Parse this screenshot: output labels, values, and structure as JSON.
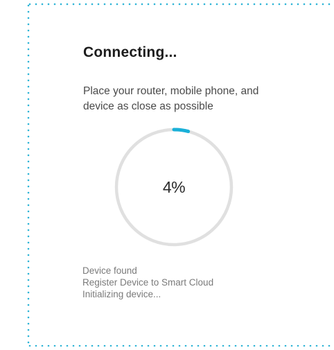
{
  "connecting": {
    "title": "Connecting...",
    "instruction_line1": "Place your router, mobile phone, and",
    "instruction_line2": "device as close as possible"
  },
  "progress": {
    "value": 4,
    "label": "4%",
    "track_color": "#e0e0e0",
    "fill_color": "#1ab0d8"
  },
  "status_steps": [
    "Device found",
    "Register Device to Smart Cloud",
    "Initializing device..."
  ],
  "colors": {
    "dotted_border": "#2bb3d6"
  }
}
